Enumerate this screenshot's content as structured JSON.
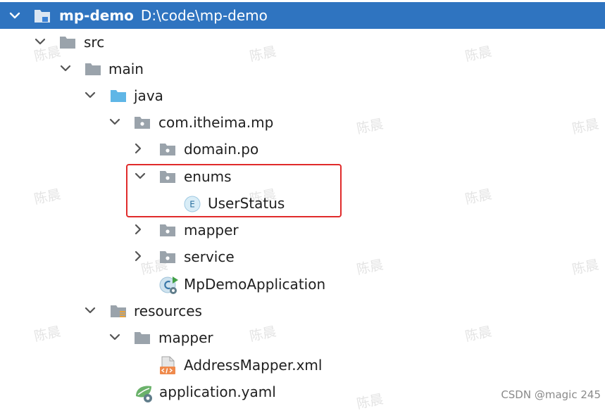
{
  "project": {
    "name": "mp-demo",
    "path": "D:\\code\\mp-demo"
  },
  "tree": {
    "src": "src",
    "main": "main",
    "java": "java",
    "package": "com.itheima.mp",
    "domain_po": "domain.po",
    "enums": "enums",
    "user_status": "UserStatus",
    "user_status_badge": "E",
    "mapper": "mapper",
    "service": "service",
    "app_class": "MpDemoApplication",
    "resources": "resources",
    "res_mapper": "mapper",
    "address_mapper": "AddressMapper.xml",
    "application_yaml": "application.yaml"
  },
  "watermark": {
    "text": "陈晨",
    "footer": "CSDN @magic 245"
  },
  "colors": {
    "header": "#2f74c0",
    "highlight": "#e02b2b",
    "folder": "#9aa3ab",
    "java_folder": "#5fb6e6"
  }
}
